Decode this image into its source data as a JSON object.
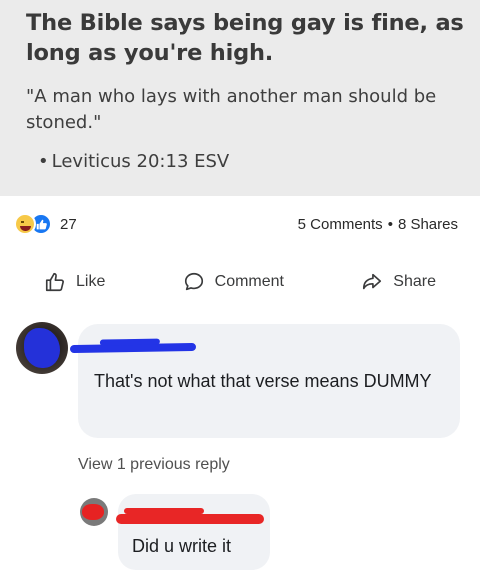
{
  "post": {
    "headline": "The Bible says being gay is fine, as long as you're high.",
    "quote": "\"A man who lays with another man should be stoned.\"",
    "citation": "Leviticus 20:13 ESV",
    "bullet": "•"
  },
  "stats": {
    "reaction_icons": [
      "haha-reaction-icon",
      "like-reaction-icon"
    ],
    "reaction_count": "27",
    "comments": "5 Comments",
    "separator": "•",
    "shares": "8 Shares"
  },
  "actions": {
    "like_label": "Like",
    "comment_label": "Comment",
    "share_label": "Share"
  },
  "comments": [
    {
      "text": "That's not what that verse means DUMMY",
      "author_redacted": true
    }
  ],
  "view_previous_label": "View 1 previous reply",
  "reply": {
    "text": "Did u write it",
    "author_redacted": true
  },
  "colors": {
    "post_image_bg": "#ebebeb",
    "bubble_bg": "#f0f2f5",
    "like_blue": "#1877f2",
    "redact_blue": "#2334e6",
    "redact_red": "#e82626"
  }
}
